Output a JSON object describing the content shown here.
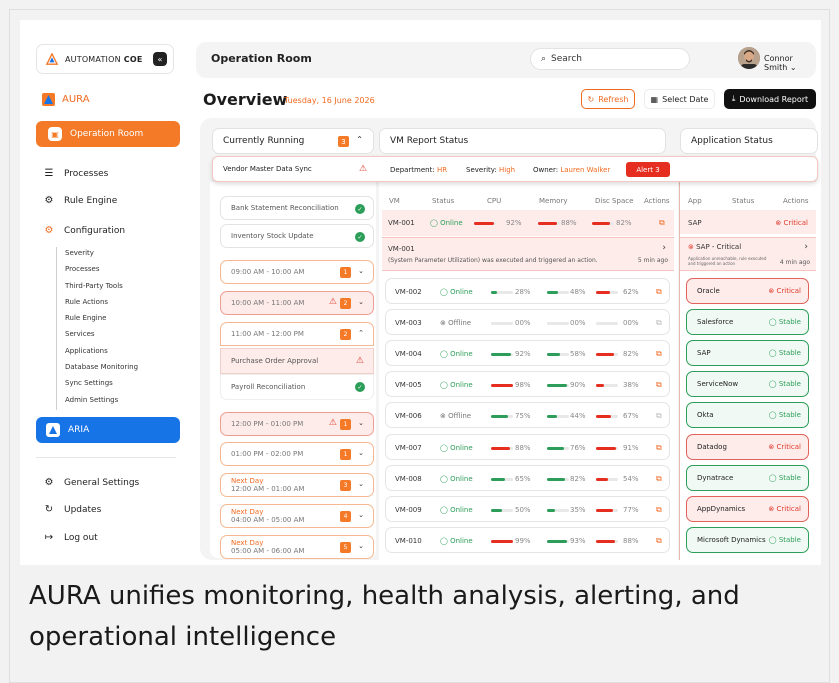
{
  "brand": {
    "name": "AUTOMATION",
    "bold": "COE",
    "collapse": "«"
  },
  "app_name": "AURA",
  "nav": {
    "active": "Operation Room",
    "processes": "Processes",
    "rule_engine": "Rule Engine",
    "configuration": "Configuration",
    "config_items": [
      "Severity",
      "Processes",
      "Third-Party Tools",
      "Rule Actions",
      "Rule Engine",
      "Services",
      "Applications",
      "Database Monitoring",
      "Sync Settings",
      "Admin Settings"
    ],
    "aria": "ARIA",
    "general_settings": "General Settings",
    "updates": "Updates",
    "logout": "Log out"
  },
  "header": {
    "title": "Operation Room",
    "search_placeholder": "Search",
    "user": "Connor Smith"
  },
  "overview": {
    "title": "Overview",
    "date": "Tuesday, 16 June 2026",
    "refresh": "Refresh",
    "select_date": "Select Date",
    "download": "Download Report"
  },
  "columns": {
    "running": "Currently Running",
    "running_badge": "3",
    "vm": "VM Report Status",
    "app": "Application Status"
  },
  "banner": {
    "process": "Vendor Master Data Sync",
    "dept_label": "Department:",
    "dept": "HR",
    "sev_label": "Severity:",
    "sev": "High",
    "owner_label": "Owner:",
    "owner": "Lauren Walker",
    "alert": "Alert 3"
  },
  "running": {
    "items": [
      "Bank Statement Reconciliation",
      "Inventory Stock Update"
    ],
    "slots": [
      {
        "time": "09:00 AM - 10:00 AM",
        "count": "1"
      },
      {
        "time": "10:00 AM - 11:00 AM",
        "count": "2"
      },
      {
        "time": "11:00 AM - 12:00 PM",
        "count": "2"
      },
      {
        "time": "12:00 PM - 01:00 PM",
        "count": "1"
      },
      {
        "time": "01:00 PM - 02:00 PM",
        "count": "1"
      },
      {
        "prefix": "Next Day",
        "time": "12:00 AM - 01:00 AM",
        "count": "3"
      },
      {
        "prefix": "Next Day",
        "time": "04:00 AM - 05:00 AM",
        "count": "4"
      },
      {
        "prefix": "Next Day",
        "time": "05:00 AM - 06:00 AM",
        "count": "5"
      }
    ],
    "procs": [
      "Purchase Order Approval",
      "Payroll Reconciliation"
    ]
  },
  "vm": {
    "headers": [
      "VM",
      "Status",
      "CPU",
      "Memory",
      "Disc Space",
      "Actions"
    ],
    "first": {
      "id": "VM-001",
      "status": "Online",
      "cpu": "92%",
      "mem": "88%",
      "disk": "82%",
      "cpu_v": 0.92,
      "mem_v": 0.88,
      "disk_v": 0.82
    },
    "alert": {
      "id": "VM-001",
      "text": "(System Parameter Utilization) was executed and triggered an action.",
      "time": "5 min ago"
    },
    "rows": [
      {
        "id": "VM-002",
        "status": "Online",
        "cpu": "28%",
        "mem": "48%",
        "disk": "62%",
        "cpu_v": 0.28,
        "mem_v": 0.48,
        "disk_v": 0.62,
        "c1": "#2c9e59",
        "c2": "#2c9e59",
        "c3": "#e62e20"
      },
      {
        "id": "VM-003",
        "status": "Offline",
        "cpu": "00%",
        "mem": "00%",
        "disk": "00%",
        "cpu_v": 0,
        "mem_v": 0,
        "disk_v": 0,
        "c1": "#ccc",
        "c2": "#ccc",
        "c3": "#ccc"
      },
      {
        "id": "VM-004",
        "status": "Online",
        "cpu": "92%",
        "mem": "58%",
        "disk": "82%",
        "cpu_v": 0.92,
        "mem_v": 0.58,
        "disk_v": 0.82,
        "c1": "#2c9e59",
        "c2": "#2c9e59",
        "c3": "#e62e20"
      },
      {
        "id": "VM-005",
        "status": "Online",
        "cpu": "98%",
        "mem": "90%",
        "disk": "38%",
        "cpu_v": 0.98,
        "mem_v": 0.9,
        "disk_v": 0.38,
        "c1": "#e62e20",
        "c2": "#2c9e59",
        "c3": "#e62e20"
      },
      {
        "id": "VM-006",
        "status": "Offline",
        "cpu": "75%",
        "mem": "44%",
        "disk": "67%",
        "cpu_v": 0.75,
        "mem_v": 0.44,
        "disk_v": 0.67,
        "c1": "#2c9e59",
        "c2": "#2c9e59",
        "c3": "#e62e20"
      },
      {
        "id": "VM-007",
        "status": "Online",
        "cpu": "88%",
        "mem": "76%",
        "disk": "91%",
        "cpu_v": 0.88,
        "mem_v": 0.76,
        "disk_v": 0.91,
        "c1": "#e62e20",
        "c2": "#2c9e59",
        "c3": "#e62e20"
      },
      {
        "id": "VM-008",
        "status": "Online",
        "cpu": "65%",
        "mem": "82%",
        "disk": "54%",
        "cpu_v": 0.65,
        "mem_v": 0.82,
        "disk_v": 0.54,
        "c1": "#2c9e59",
        "c2": "#2c9e59",
        "c3": "#e62e20"
      },
      {
        "id": "VM-009",
        "status": "Online",
        "cpu": "50%",
        "mem": "35%",
        "disk": "77%",
        "cpu_v": 0.5,
        "mem_v": 0.35,
        "disk_v": 0.77,
        "c1": "#2c9e59",
        "c2": "#2c9e59",
        "c3": "#e62e20"
      },
      {
        "id": "VM-010",
        "status": "Online",
        "cpu": "99%",
        "mem": "93%",
        "disk": "88%",
        "cpu_v": 0.99,
        "mem_v": 0.93,
        "disk_v": 0.88,
        "c1": "#e62e20",
        "c2": "#2c9e59",
        "c3": "#e62e20"
      }
    ]
  },
  "app": {
    "headers": [
      "App",
      "Status",
      "Actions"
    ],
    "first": {
      "name": "SAP",
      "status": "Critical"
    },
    "alert": {
      "title": "SAP - Critical",
      "desc": "Application unreachable, rule executed and triggered an action",
      "time": "4 min ago"
    },
    "rows": [
      {
        "name": "Oracle",
        "status": "Critical",
        "kind": "crit"
      },
      {
        "name": "Salesforce",
        "status": "Stable",
        "kind": "stab"
      },
      {
        "name": "SAP",
        "status": "Stable",
        "kind": "stab"
      },
      {
        "name": "ServiceNow",
        "status": "Stable",
        "kind": "stab"
      },
      {
        "name": "Okta",
        "status": "Stable",
        "kind": "stab"
      },
      {
        "name": "Datadog",
        "status": "Critical",
        "kind": "crit"
      },
      {
        "name": "Dynatrace",
        "status": "Stable",
        "kind": "stab"
      },
      {
        "name": "AppDynamics",
        "status": "Critical",
        "kind": "crit"
      },
      {
        "name": "Microsoft Dynamics",
        "status": "Stable",
        "kind": "stab"
      }
    ]
  },
  "caption": "AURA unifies monitoring, health analysis, alerting, and operational intelligence"
}
